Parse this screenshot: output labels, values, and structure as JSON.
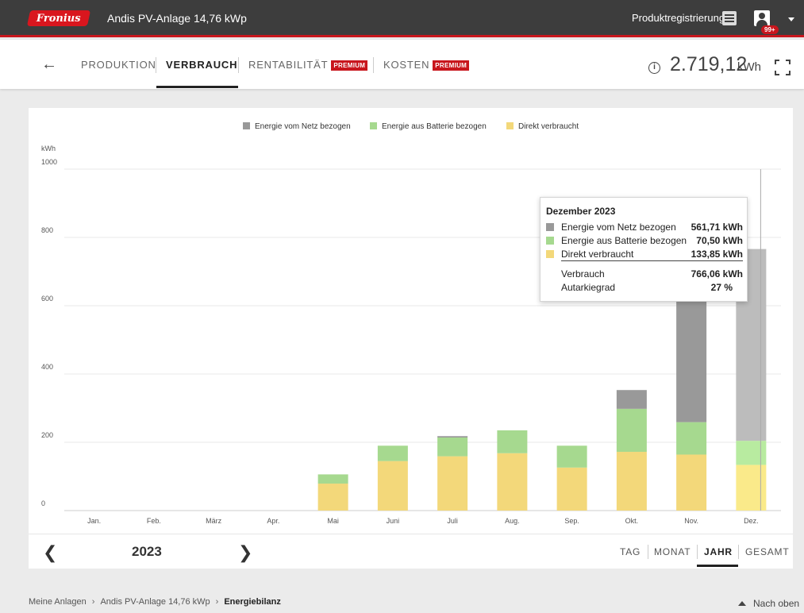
{
  "header": {
    "logo_text": "Fronius",
    "system_title": "Andis PV-Anlage 14,76 kWp",
    "product_registration": "Produktregistrierung",
    "notification_badge": "99+"
  },
  "nav": {
    "tabs": [
      {
        "label": "PRODUKTION",
        "premium": false
      },
      {
        "label": "VERBRAUCH",
        "premium": false,
        "active": true
      },
      {
        "label": "RENTABILITÄT",
        "premium": true
      },
      {
        "label": "KOSTEN",
        "premium": true
      }
    ],
    "premium_label": "PREMIUM",
    "total_value": "2.719,12",
    "total_unit": "kWh"
  },
  "colors": {
    "grid": "#999999",
    "battery": "#a6d98f",
    "direct": "#f3d87a",
    "grid_hl": "#bcbcbc",
    "battery_hl": "#b8eba0",
    "direct_hl": "#faea8a"
  },
  "chart_data": {
    "type": "bar",
    "stacked": true,
    "ylabel": "kWh",
    "ylim": [
      0,
      1000
    ],
    "yticks": [
      0,
      200,
      400,
      600,
      800,
      1000
    ],
    "categories": [
      "Jan.",
      "Feb.",
      "März",
      "Apr.",
      "Mai",
      "Juni",
      "Juli",
      "Aug.",
      "Sep.",
      "Okt.",
      "Nov.",
      "Dez."
    ],
    "series": [
      {
        "name": "Direkt verbraucht",
        "values": [
          0,
          0,
          0,
          0,
          79,
          145,
          159,
          168,
          126,
          172,
          164,
          133.85
        ]
      },
      {
        "name": "Energie aus Batterie bezogen",
        "values": [
          0,
          0,
          0,
          0,
          27,
          45,
          55,
          67,
          64,
          126,
          95,
          70.5
        ]
      },
      {
        "name": "Energie vom Netz bezogen",
        "values": [
          0,
          0,
          0,
          0,
          0,
          0,
          4,
          0,
          0,
          55,
          381,
          561.71
        ]
      }
    ],
    "legend": [
      "Energie vom Netz bezogen",
      "Energie aus Batterie bezogen",
      "Direkt verbraucht"
    ],
    "legend_position": "top-center",
    "highlighted_category": "Dez."
  },
  "tooltip": {
    "title": "Dezember 2023",
    "rows": [
      {
        "label": "Energie vom Netz bezogen",
        "value": "561,71 kWh"
      },
      {
        "label": "Energie aus Batterie bezogen",
        "value": "70,50 kWh"
      },
      {
        "label": "Direkt verbraucht",
        "value": "133,85 kWh"
      }
    ],
    "consumption_label": "Verbrauch",
    "consumption_value": "766,06 kWh",
    "autarky_label": "Autarkiegrad",
    "autarky_value": "27 %"
  },
  "footer": {
    "year": "2023",
    "periods": [
      "TAG",
      "MONAT",
      "JAHR",
      "GESAMT"
    ],
    "active_period": "JAHR"
  },
  "breadcrumb": {
    "items": [
      "Meine Anlagen",
      "Andis PV-Anlage 14,76 kWp",
      "Energiebilanz"
    ]
  },
  "to_top_label": "Nach oben"
}
